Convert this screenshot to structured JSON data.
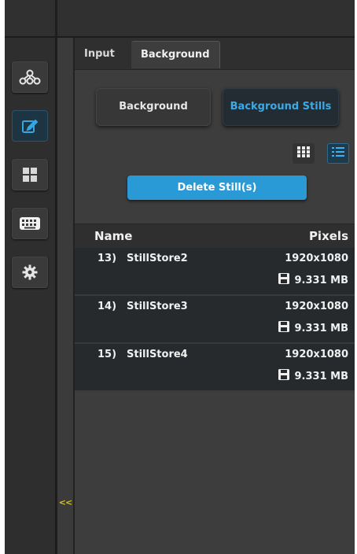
{
  "nav": {
    "items": [
      {
        "icon": "network-icon",
        "active": false
      },
      {
        "icon": "edit-icon",
        "active": true
      },
      {
        "icon": "grid-icon",
        "active": false
      },
      {
        "icon": "keyboard-icon",
        "active": false
      },
      {
        "icon": "gear-icon",
        "active": false
      }
    ],
    "collapse_label": "<<"
  },
  "tabs": [
    {
      "label": "Input",
      "selected": false
    },
    {
      "label": "Background",
      "selected": true
    }
  ],
  "mode_buttons": {
    "background_label": "Background",
    "stills_label": "Background Stills",
    "selected": "Background Stills"
  },
  "view_toggle": {
    "options": [
      "grid-view-icon",
      "list-view-icon"
    ],
    "selected": "list-view-icon"
  },
  "actions": {
    "delete_label": "Delete Still(s)"
  },
  "table": {
    "columns": {
      "name": "Name",
      "pixels": "Pixels"
    },
    "rows": [
      {
        "index": "13)",
        "name": "StillStore2",
        "resolution": "1920x1080",
        "size": "9.331 MB"
      },
      {
        "index": "14)",
        "name": "StillStore3",
        "resolution": "1920x1080",
        "size": "9.331 MB"
      },
      {
        "index": "15)",
        "name": "StillStore4",
        "resolution": "1920x1080",
        "size": "9.331 MB"
      }
    ]
  },
  "colors": {
    "accent": "#2a9ad6",
    "accent_text": "#3ea9e4",
    "collapse_text": "#d6c622",
    "panel_bg": "#3d3d3d",
    "row_bg": "#262a2d"
  }
}
